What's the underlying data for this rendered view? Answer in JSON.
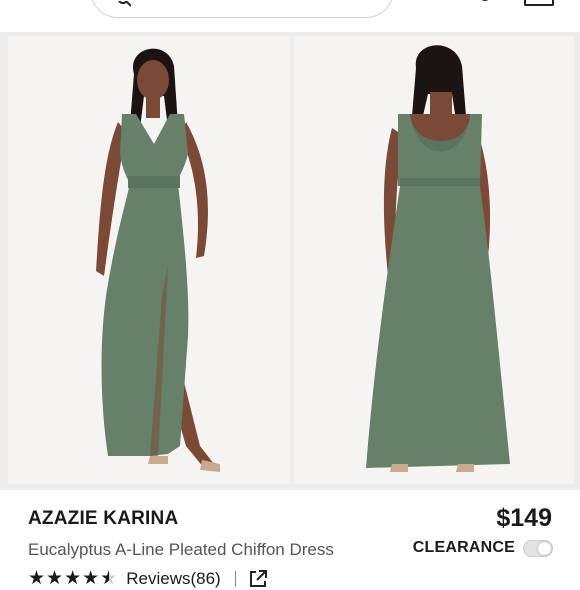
{
  "header": {
    "menu_icon": "hamburger-menu-icon",
    "search_icon": "search-icon",
    "account_icon": "account-icon",
    "bag_icon": "shopping-bag-icon"
  },
  "gallery": {
    "images": [
      {
        "view": "front",
        "icon": "product-photo-front"
      },
      {
        "view": "back",
        "icon": "product-photo-back"
      }
    ],
    "dress_color": "#66806a"
  },
  "product": {
    "brand": "AZAZIE KARINA",
    "name": "Eucalyptus A-Line Pleated Chiffon Dress",
    "price": "$149",
    "clearance_label": "CLEARANCE",
    "clearance_enabled": false,
    "rating": 4.5,
    "rating_max": 5,
    "reviews_label": "Reviews(86)",
    "share_icon": "share-external-icon"
  }
}
